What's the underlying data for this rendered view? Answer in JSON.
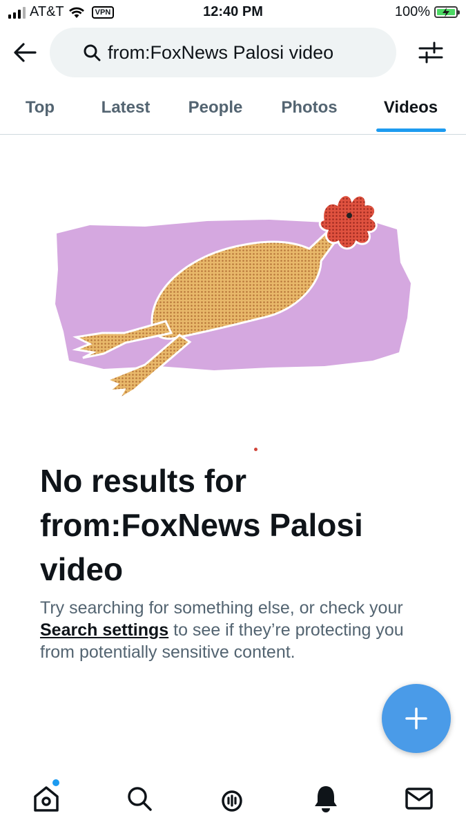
{
  "status_bar": {
    "carrier": "AT&T",
    "vpn": "VPN",
    "time": "12:40 PM",
    "battery": "100%"
  },
  "header": {
    "search_query": "from:FoxNews Palosi video"
  },
  "tabs": [
    {
      "label": "Top",
      "active": false
    },
    {
      "label": "Latest",
      "active": false
    },
    {
      "label": "People",
      "active": false
    },
    {
      "label": "Photos",
      "active": false
    },
    {
      "label": "Videos",
      "active": true
    }
  ],
  "empty_state": {
    "heading": "No results for from:FoxNews Palosi video",
    "text_before_link": "Try searching for something else, or check your ",
    "link_text": "Search settings",
    "text_after_link": " to see if they’re protecting you from potentially sensitive content."
  },
  "icons": {
    "back": "back-arrow-icon",
    "search": "search-icon",
    "filter": "filter-sliders-icon",
    "compose": "plus-icon",
    "nav": [
      "home-icon",
      "search-icon",
      "spaces-icon",
      "bell-icon",
      "mail-icon"
    ]
  },
  "colors": {
    "accent": "#1d9bf0",
    "fab": "#4a9be8",
    "illustration_bg": "#d5a8e0",
    "muted_text": "#536471"
  }
}
